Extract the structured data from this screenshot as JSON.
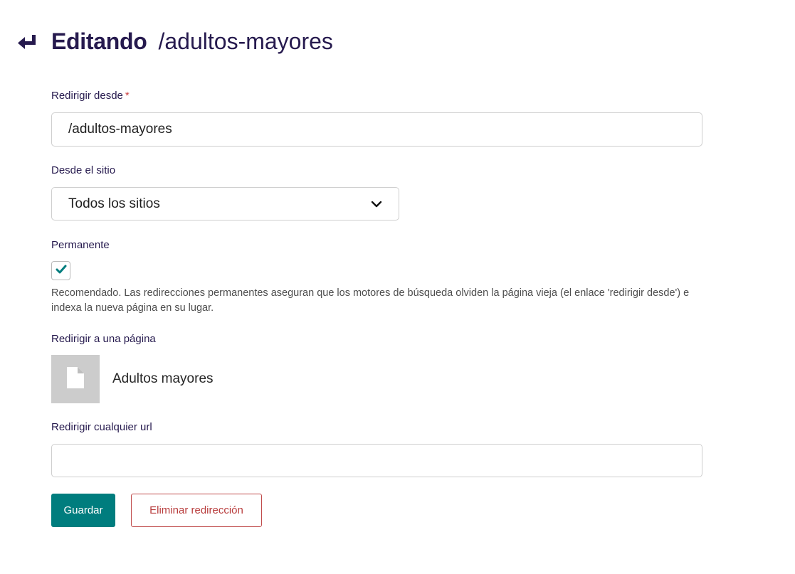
{
  "header": {
    "icon": "redirect-return-icon",
    "title": "Editando",
    "subtitle": "/adultos-mayores"
  },
  "form": {
    "redirect_from": {
      "label": "Redirigir desde",
      "required_marker": "*",
      "value": "/adultos-mayores"
    },
    "site": {
      "label": "Desde el sitio",
      "selected": "Todos los sitios"
    },
    "permanent": {
      "label": "Permanente",
      "checked": true,
      "help": "Recomendado. Las redirecciones permanentes aseguran que los motores de búsqueda olviden la página vieja (el enlace 'redirigir desde') e indexa la nueva página en su lugar."
    },
    "redirect_page": {
      "label": "Redirigir a una página",
      "page_icon": "document-icon",
      "page_title": "Adultos mayores"
    },
    "redirect_link": {
      "label": "Redirigir cualquier url",
      "value": ""
    }
  },
  "actions": {
    "save_label": "Guardar",
    "delete_label": "Eliminar redirección"
  },
  "colors": {
    "primary": "#007d7e",
    "heading": "#261a4e",
    "danger": "#b83c3c"
  }
}
